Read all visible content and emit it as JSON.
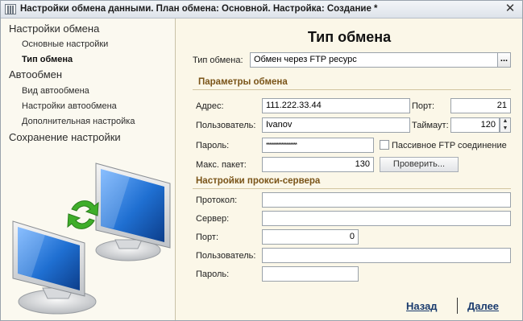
{
  "window": {
    "title": "Настройки обмена данными. План обмена: Основной. Настройка: Создание *",
    "close_glyph": "✕"
  },
  "sidebar": {
    "items": [
      {
        "label": "Настройки обмена"
      },
      {
        "label": "Основные настройки"
      },
      {
        "label": "Тип обмена"
      },
      {
        "label": "Автообмен"
      },
      {
        "label": "Вид автообмена"
      },
      {
        "label": "Настройки автообмена"
      },
      {
        "label": "Дополнительная настройка"
      },
      {
        "label": "Сохранение настройки"
      }
    ],
    "illustration": "two-monitors-sync-icon"
  },
  "main": {
    "title": "Тип обмена",
    "exchange_type": {
      "label": "Тип обмена:",
      "value": "Обмен через FTP ресурс",
      "button": "..."
    },
    "params_section": "Параметры обмена",
    "address": {
      "label": "Адрес:",
      "value": "111.222.33.44"
    },
    "port": {
      "label": "Порт:",
      "value": "21"
    },
    "user": {
      "label": "Пользователь:",
      "value": "Ivanov"
    },
    "timeout": {
      "label": "Таймаут:",
      "value": "120"
    },
    "password": {
      "label": "Пароль:",
      "value": "******************"
    },
    "passive": {
      "label": "Пассивное FTP соединение",
      "checked": false
    },
    "max_packet": {
      "label": "Макс. пакет:",
      "value": "130"
    },
    "check_button": "Проверить...",
    "proxy_section": "Настройки прокси-сервера",
    "proxy": {
      "protocol": {
        "label": "Протокол:",
        "value": ""
      },
      "server": {
        "label": "Сервер:",
        "value": ""
      },
      "port": {
        "label": "Порт:",
        "value": "0"
      },
      "user": {
        "label": "Пользователь:",
        "value": ""
      },
      "password": {
        "label": "Пароль:",
        "value": ""
      }
    }
  },
  "footer": {
    "back": "Назад",
    "next": "Далее"
  },
  "colors": {
    "background": "#fbf7e8",
    "section_header": "#7a5418",
    "link": "#1a3b6e",
    "monitor_screen": "#1f6fd1",
    "sync_arrows": "#3fae2a"
  }
}
